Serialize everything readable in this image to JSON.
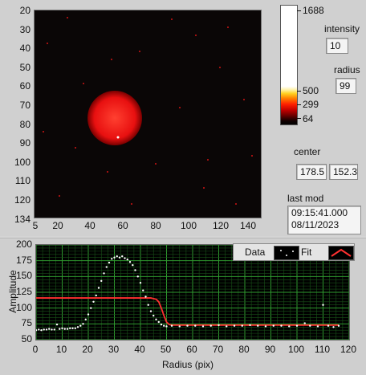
{
  "image_view": {
    "y_ticks": [
      "20",
      "30",
      "40",
      "50",
      "60",
      "70",
      "80",
      "90",
      "100",
      "110",
      "120",
      "134"
    ],
    "x_ticks": [
      "5",
      "20",
      "40",
      "60",
      "80",
      "100",
      "120",
      "140"
    ],
    "colors": {
      "background": "#0a0606",
      "spot": "#e81010",
      "spot_core": "#ff3a2a"
    }
  },
  "colorbar": {
    "ticks": [
      "1688",
      "500",
      "299",
      "64"
    ],
    "colors": [
      "#ffffff",
      "#ffd020",
      "#ff8000",
      "#ff2000",
      "#c00000",
      "#000000"
    ]
  },
  "controls": {
    "intensity_label": "intensity",
    "intensity_value": "10",
    "radius_label": "radius",
    "radius_value": "99",
    "center_label": "center",
    "center_x": "178.5",
    "center_y": "152.3",
    "last_mod_label": "last mod",
    "last_mod_time": "09:15:41.000",
    "last_mod_date": "08/11/2023"
  },
  "plot": {
    "legend_data": "Data",
    "legend_fit": "Fit",
    "ylabel": "Amplitude",
    "xlabel": "Radius (pix)",
    "y_ticks": [
      "200",
      "175",
      "150",
      "125",
      "100",
      "75",
      "50"
    ],
    "x_ticks": [
      "0",
      "10",
      "20",
      "30",
      "40",
      "50",
      "60",
      "70",
      "80",
      "90",
      "100",
      "110",
      "120"
    ]
  },
  "chart_data": {
    "type": "scatter",
    "xlabel": "Radius (pix)",
    "ylabel": "Amplitude",
    "xlim": [
      0,
      120
    ],
    "ylim": [
      50,
      200
    ],
    "grid": true,
    "legend_placement": "top-right",
    "series": [
      {
        "name": "Data",
        "color": "#ffffff",
        "x": [
          0,
          1,
          2,
          3,
          4,
          5,
          6,
          7,
          8,
          9,
          10,
          11,
          12,
          13,
          14,
          15,
          16,
          17,
          18,
          19,
          20,
          21,
          22,
          23,
          24,
          25,
          26,
          27,
          28,
          29,
          30,
          31,
          32,
          33,
          34,
          35,
          36,
          37,
          38,
          39,
          40,
          41,
          42,
          43,
          44,
          45,
          46,
          47,
          48,
          49,
          50,
          52,
          55,
          58,
          61,
          64,
          67,
          70,
          73,
          76,
          79,
          82,
          85,
          88,
          91,
          94,
          97,
          100,
          103,
          105,
          108,
          110,
          112,
          114,
          116
        ],
        "y": [
          65,
          66,
          65,
          66,
          66,
          67,
          66,
          66,
          74,
          67,
          68,
          67,
          67,
          68,
          68,
          68,
          70,
          72,
          75,
          82,
          90,
          100,
          110,
          120,
          132,
          143,
          155,
          165,
          172,
          178,
          180,
          182,
          180,
          182,
          179,
          177,
          173,
          168,
          160,
          150,
          140,
          128,
          118,
          105,
          95,
          88,
          82,
          78,
          74,
          72,
          71,
          72,
          71,
          72,
          72,
          71,
          72,
          73,
          71,
          72,
          72,
          73,
          72,
          71,
          72,
          72,
          71,
          72,
          76,
          72,
          71,
          105,
          72,
          70,
          72
        ]
      },
      {
        "name": "Fit",
        "color": "#ff3030",
        "x": [
          0,
          5,
          10,
          15,
          20,
          25,
          30,
          35,
          40,
          44,
          46,
          47,
          48,
          49,
          50,
          51,
          52,
          55,
          60,
          70,
          80,
          90,
          100,
          110,
          116
        ],
        "y": [
          116,
          116,
          116,
          116,
          116,
          116,
          116,
          116,
          116,
          116,
          114,
          110,
          100,
          88,
          78,
          74,
          73,
          73,
          73,
          73,
          73,
          73,
          73,
          73,
          73
        ]
      }
    ]
  }
}
